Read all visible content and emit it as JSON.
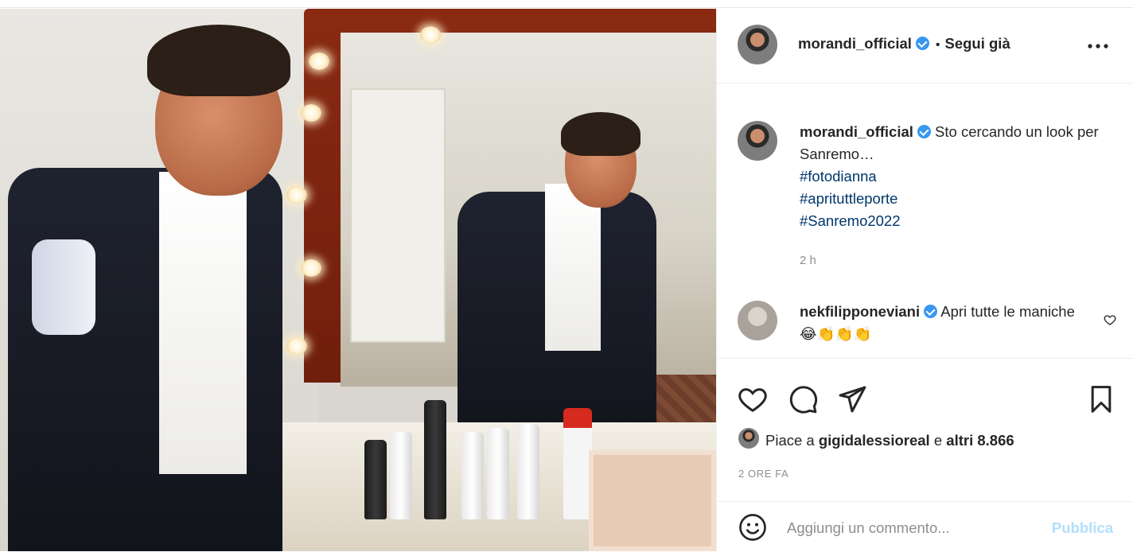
{
  "post": {
    "author": "morandi_official",
    "follow_status": "Segui già",
    "more_label": "•••",
    "caption": {
      "user": "morandi_official",
      "text": "Sto cercando un look per Sanremo…",
      "hashtags": [
        "#fotodianna",
        "#aprituttleporte",
        "#Sanremo2022"
      ],
      "time": "2 h"
    },
    "top_comment": {
      "user": "nekfilipponeviani",
      "text": "Apri tutte le maniche😂👏👏👏"
    },
    "likes": {
      "prefix": "Piace a",
      "user": "gigidalessioreal",
      "joiner": "e",
      "others": "altri 8.866"
    },
    "posted_ago": "2 ORE FA",
    "add_comment": {
      "placeholder": "Aggiungi un commento...",
      "publish": "Pubblica"
    }
  },
  "icons": {
    "like": "heart-icon",
    "comment": "comment-icon",
    "share": "paper-plane-icon",
    "save": "bookmark-icon",
    "emoji": "smiley-icon",
    "comment_like": "heart-icon",
    "verified": "verified-badge-icon",
    "more": "more-options-icon"
  },
  "colors": {
    "link": "#00376b",
    "verified": "#3897f0",
    "muted": "#8e8e8e",
    "publish_disabled": "#b2dffc"
  }
}
